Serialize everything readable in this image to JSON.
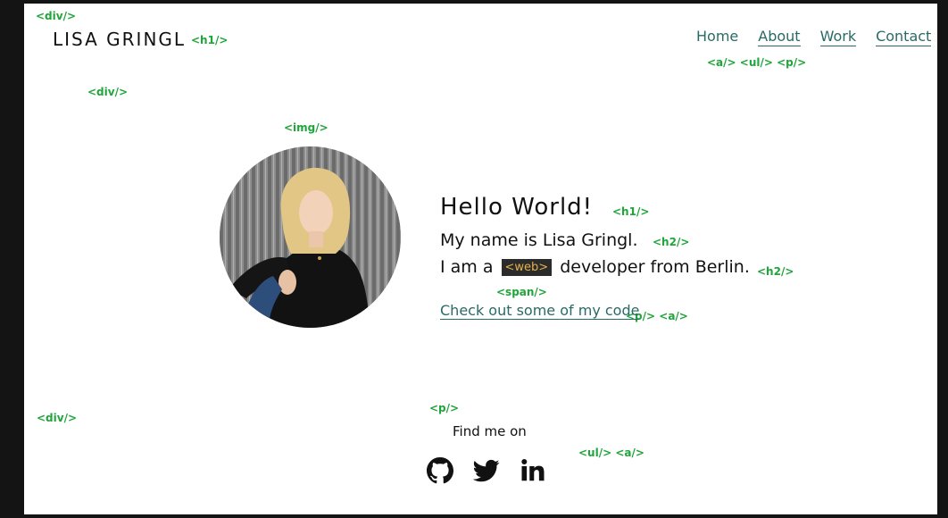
{
  "header": {
    "brand": "LISA GRINGL",
    "nav": [
      {
        "label": "Home"
      },
      {
        "label": "About"
      },
      {
        "label": "Work"
      },
      {
        "label": "Contact"
      }
    ]
  },
  "hero": {
    "greeting": "Hello World!",
    "name_line": "My name is Lisa Gringl.",
    "role_prefix": "I am a",
    "role_tag": "<web>",
    "role_suffix": "developer from Berlin.",
    "code_link": "Check out some of my code"
  },
  "footer": {
    "find_me": "Find me on",
    "social": [
      {
        "icon": "github-icon"
      },
      {
        "icon": "twitter-icon"
      },
      {
        "icon": "linkedin-icon"
      }
    ]
  },
  "annotations": {
    "div_top": "<div/>",
    "h1_brand": "<h1/>",
    "nav_tags": "<a/> <ul/> <p/>",
    "div_hero": "<div/>",
    "img": "<img/>",
    "h1_hello": "<h1/>",
    "h2_name": "<h2/>",
    "h2_role": "<h2/>",
    "span": "<span/>",
    "p_a_link": "<p/> <a/>",
    "div_footer": "<div/>",
    "p_footer": "<p/>",
    "ul_a_social": "<ul/> <a/>"
  },
  "colors": {
    "accent": "#2a6a66",
    "annotation": "#1fa53a",
    "chip_bg": "#2b2b2b",
    "chip_text": "#e2b14a",
    "frame": "#141414"
  }
}
